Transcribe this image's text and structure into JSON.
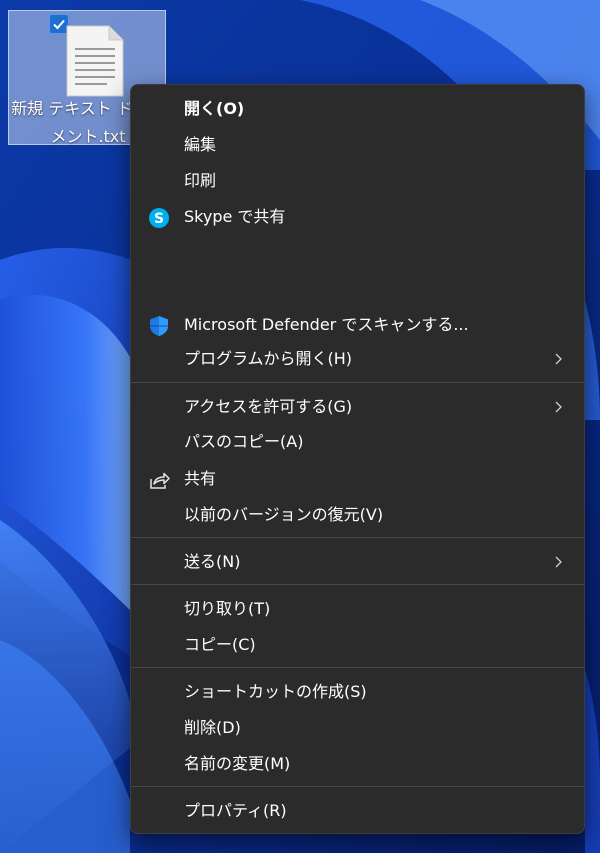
{
  "desktop": {
    "file": {
      "label": "新規 テキスト ドキュメント.txt",
      "selected": true,
      "icon": "text-file-icon"
    }
  },
  "context_menu": {
    "open": {
      "label": "開く(O)",
      "icon": null
    },
    "edit": {
      "label": "編集"
    },
    "print": {
      "label": "印刷"
    },
    "skype_share": {
      "label": "Skype で共有",
      "icon": "skype-icon"
    },
    "defender_scan": {
      "label": "Microsoft Defender でスキャンする...",
      "icon": "defender-shield-icon"
    },
    "open_with": {
      "label": "プログラムから開く(H)",
      "has_submenu": true
    },
    "give_access": {
      "label": "アクセスを許可する(G)",
      "has_submenu": true
    },
    "copy_path": {
      "label": "パスのコピー(A)"
    },
    "share": {
      "label": "共有",
      "icon": "share-icon"
    },
    "restore_versions": {
      "label": "以前のバージョンの復元(V)"
    },
    "send_to": {
      "label": "送る(N)",
      "has_submenu": true
    },
    "cut": {
      "label": "切り取り(T)"
    },
    "copy": {
      "label": "コピー(C)"
    },
    "create_shortcut": {
      "label": "ショートカットの作成(S)"
    },
    "delete": {
      "label": "削除(D)"
    },
    "rename": {
      "label": "名前の変更(M)"
    },
    "properties": {
      "label": "プロパティ(R)"
    }
  },
  "colors": {
    "menu_bg": "#2b2b2b",
    "menu_text": "#ffffff",
    "separator": "#454545",
    "selection_bg": "rgba(200,215,240,0.55)",
    "skype": "#00aff0",
    "defender": "#1f7ae0"
  }
}
